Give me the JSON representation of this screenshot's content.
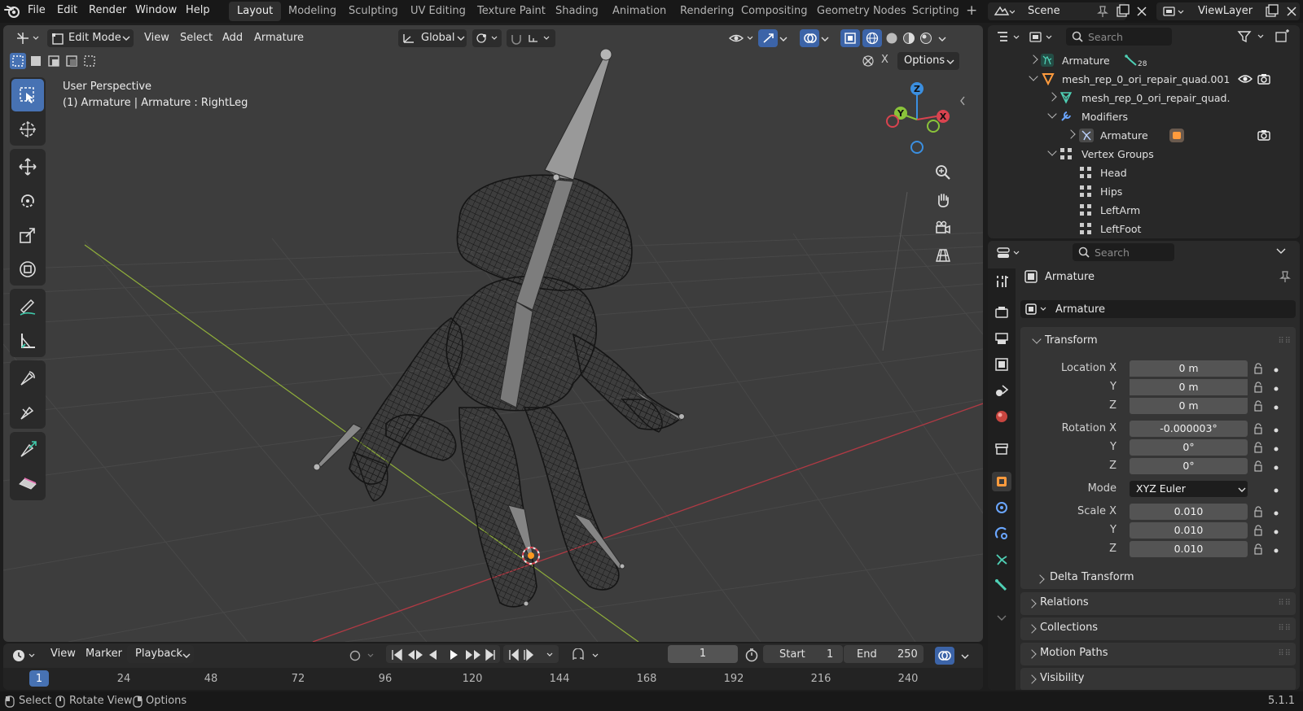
{
  "menu": [
    "File",
    "Edit",
    "Render",
    "Window",
    "Help"
  ],
  "workspaces": [
    {
      "label": "Layout",
      "active": true
    },
    {
      "label": "Modeling"
    },
    {
      "label": "Sculpting"
    },
    {
      "label": "UV Editing"
    },
    {
      "label": "Texture Paint"
    },
    {
      "label": "Shading"
    },
    {
      "label": "Animation"
    },
    {
      "label": "Rendering"
    },
    {
      "label": "Compositing"
    },
    {
      "label": "Geometry Nodes"
    },
    {
      "label": "Scripting"
    }
  ],
  "scene": {
    "label": "Scene",
    "view_layer": "ViewLayer"
  },
  "viewport": {
    "mode": "Edit Mode",
    "menus": [
      "View",
      "Select",
      "Add",
      "Armature"
    ],
    "orientation": "Global",
    "options_label": "Options",
    "view_name": "User Perspective",
    "context": "(1) Armature | Armature : RightLeg",
    "gizmo": {
      "z": "Z",
      "y": "Y",
      "x": "X"
    }
  },
  "timeline": {
    "menus": [
      "View",
      "Marker",
      "Playback"
    ],
    "current_frame": "1",
    "start_label": "Start",
    "start_value": "1",
    "end_label": "End",
    "end_value": "250",
    "ruler": [
      "1",
      "24",
      "48",
      "72",
      "96",
      "120",
      "144",
      "168",
      "192",
      "216",
      "240"
    ]
  },
  "status": {
    "select": "Select",
    "rotate": "Rotate View",
    "options": "Options",
    "version": "5.1.1"
  },
  "outliner": {
    "search_placeholder": "Search",
    "rows": [
      {
        "label": "Armature",
        "badge": "28"
      },
      {
        "label": "mesh_rep_0_ori_repair_quad.001"
      },
      {
        "label": "mesh_rep_0_ori_repair_quad."
      },
      {
        "label": "Modifiers"
      },
      {
        "label": "Armature"
      },
      {
        "label": "Vertex Groups"
      },
      {
        "label": "Head"
      },
      {
        "label": "Hips"
      },
      {
        "label": "LeftArm"
      },
      {
        "label": "LeftFoot"
      }
    ]
  },
  "properties": {
    "search_placeholder": "Search",
    "object_name": "Armature",
    "object_field": "Armature",
    "transform_title": "Transform",
    "location_label": "Location X",
    "y_label": "Y",
    "z_label": "Z",
    "location": [
      "0 m",
      "0 m",
      "0 m"
    ],
    "rotation_label": "Rotation X",
    "rotation": [
      "-0.000003°",
      "0°",
      "0°"
    ],
    "mode_label": "Mode",
    "mode_value": "XYZ Euler",
    "scale_label": "Scale X",
    "scale": [
      "0.010",
      "0.010",
      "0.010"
    ],
    "delta": "Delta Transform",
    "sections": [
      "Relations",
      "Collections",
      "Motion Paths",
      "Visibility"
    ]
  },
  "colors": {
    "accent": "#4772b3",
    "x_axis": "#d9434f",
    "y_axis": "#8ac33a",
    "z_axis": "#3b8fe0"
  }
}
